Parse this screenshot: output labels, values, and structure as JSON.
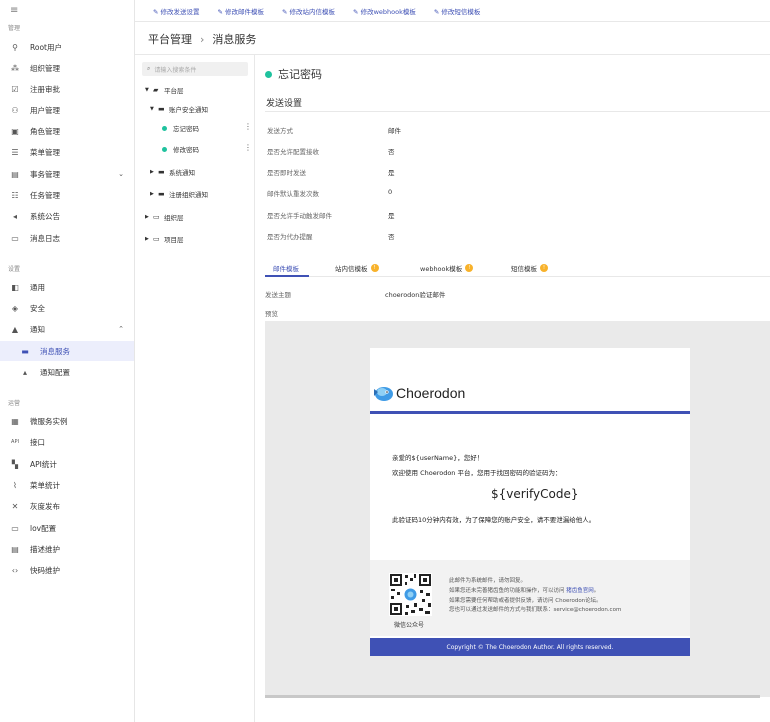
{
  "sidebar": {
    "menu_icon": "≡",
    "section_manage": "管理",
    "manage_items": [
      {
        "label": "Root用户",
        "icon": "root-user-icon"
      },
      {
        "label": "组织管理",
        "icon": "organization-icon"
      },
      {
        "label": "注册审批",
        "icon": "approval-icon"
      },
      {
        "label": "用户管理",
        "icon": "user-icon"
      },
      {
        "label": "角色管理",
        "icon": "role-icon"
      },
      {
        "label": "菜单管理",
        "icon": "menu-list-icon"
      },
      {
        "label": "事务管理",
        "icon": "transaction-icon"
      },
      {
        "label": "任务管理",
        "icon": "task-icon"
      },
      {
        "label": "系统公告",
        "icon": "announcement-icon"
      },
      {
        "label": "消息日志",
        "icon": "message-log-icon"
      }
    ],
    "section_settings": "设置",
    "settings_items": [
      {
        "label": "通用",
        "icon": "general-icon"
      },
      {
        "label": "安全",
        "icon": "security-icon"
      },
      {
        "label": "通知",
        "icon": "bell-icon"
      },
      {
        "label": "消息服务",
        "icon": "message-icon"
      },
      {
        "label": "通知配置",
        "icon": "notify-config-icon"
      }
    ],
    "section_ops": "运营",
    "ops_items": [
      {
        "label": "微服务实例",
        "icon": "microservice-icon"
      },
      {
        "label": "接口",
        "icon": "api-icon"
      },
      {
        "label": "API统计",
        "icon": "api-stats-icon"
      },
      {
        "label": "菜单统计",
        "icon": "menu-stats-icon"
      },
      {
        "label": "灰度发布",
        "icon": "gray-release-icon"
      },
      {
        "label": "lov配置",
        "icon": "lov-icon"
      },
      {
        "label": "描述维护",
        "icon": "description-icon"
      },
      {
        "label": "快码维护",
        "icon": "code-icon"
      }
    ]
  },
  "topbar": {
    "links": [
      "修改发送设置",
      "修改邮件模板",
      "修改站内信模板",
      "修改webhook模板",
      "修改短信模板"
    ]
  },
  "breadcrumb": {
    "root": "平台管理",
    "separator": "›",
    "current": "消息服务"
  },
  "tree": {
    "search_placeholder": "请输入搜索条件",
    "platform": "平台层",
    "account_notify": "账户安全通知",
    "forgot_password": "忘记密码",
    "change_password": "修改密码",
    "system_notify": "系统通知",
    "register_org_notify": "注册组织通知",
    "org_layer": "组织层",
    "project_layer": "项目层"
  },
  "detail": {
    "title": "忘记密码",
    "section": "发送设置",
    "fields": [
      {
        "label": "发送方式",
        "value": "邮件"
      },
      {
        "label": "是否允许配置接收",
        "value": "否"
      },
      {
        "label": "是否即时发送",
        "value": "是"
      },
      {
        "label": "邮件默认重发次数",
        "value": "0"
      },
      {
        "label": "是否允许手动触发邮件",
        "value": "是"
      },
      {
        "label": "是否为代办提醒",
        "value": "否"
      }
    ],
    "tabs": [
      {
        "label": "邮件模板",
        "warn": false
      },
      {
        "label": "站内信模板",
        "warn": true
      },
      {
        "label": "webhook模板",
        "warn": true
      },
      {
        "label": "短信模板",
        "warn": true
      }
    ],
    "subject_label": "发送主题",
    "subject_value": "choerodon验证邮件",
    "preview_label": "预览"
  },
  "email": {
    "logo_text": "Choerodon",
    "greeting": "亲爱的${userName}，您好！",
    "intro": "欢迎使用 Choerodon 平台，您用于找回密码的验证码为：",
    "code": "${verifyCode}",
    "note": "此验证码10分钟内有效，为了保障您的账户安全，请不要泄漏给他人。",
    "qr_label": "微信公众号",
    "footer_1": "此邮件为系统邮件，请勿回复。",
    "footer_2_pre": "如果您还未完善猪齿鱼的功能和操作，可以访问 ",
    "footer_2_link": "猪齿鱼官网",
    "footer_2_post": "。",
    "footer_3": "如果您需要任何帮助或者提供反馈，请访问 Choerodon论坛。",
    "footer_4": "您也可以通过发送邮件的方式与我们联系：service@choerodon.com",
    "copyright": "Copyright © The Choerodon Author. All rights reserved."
  },
  "colors": {
    "accent": "#3f51b5",
    "status_dot": "#1fc29e",
    "warn": "#f8b22b"
  }
}
